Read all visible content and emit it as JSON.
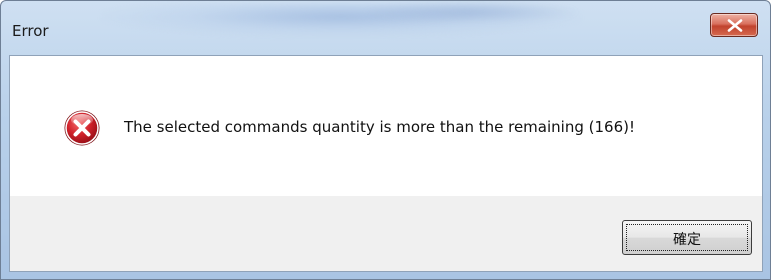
{
  "window": {
    "title": "Error"
  },
  "dialog": {
    "message": "The selected commands quantity is more than the remaining (166)!",
    "icon": "error-icon",
    "ok_label": "確定"
  },
  "colors": {
    "titlebar": "#b9d1ea",
    "close_button": "#c1432e",
    "error_icon": "#c8102e",
    "content_bg": "#ffffff",
    "button_area_bg": "#f0f0f0"
  }
}
